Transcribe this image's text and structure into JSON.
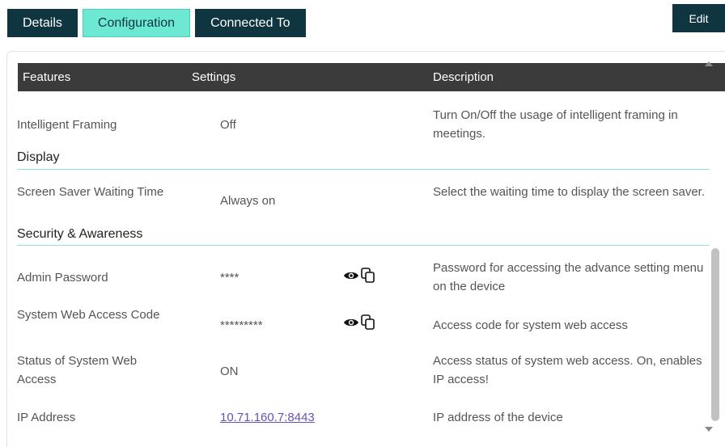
{
  "tabs": {
    "details": "Details",
    "configuration": "Configuration",
    "connected_to": "Connected To"
  },
  "edit_label": "Edit",
  "table": {
    "headers": {
      "features": "Features",
      "settings": "Settings",
      "description": "Description"
    },
    "rows": [
      {
        "feature": "Intelligent Framing",
        "setting": "Off",
        "description": "Turn On/Off the usage of intelligent framing in meetings."
      },
      {
        "feature": "Screen Saver Waiting Time",
        "setting": "Always on",
        "description": "Select the waiting time to display the screen saver."
      },
      {
        "feature": "Admin Password",
        "setting": "****",
        "description": "Password for accessing the advance setting menu on the device"
      },
      {
        "feature": "System Web Access Code",
        "setting": "*********",
        "description": "Access code for system web access"
      },
      {
        "feature": "Status of System Web Access",
        "setting": "ON",
        "description": "Access status of system web access. On, enables IP access!"
      },
      {
        "feature": "IP Address",
        "setting": "10.71.160.7:8443",
        "description": "IP address of the device"
      }
    ],
    "sections": {
      "display": "Display",
      "security": "Security & Awareness"
    }
  },
  "icons": {
    "reveal": "eye-icon",
    "copy": "copy-icon"
  }
}
